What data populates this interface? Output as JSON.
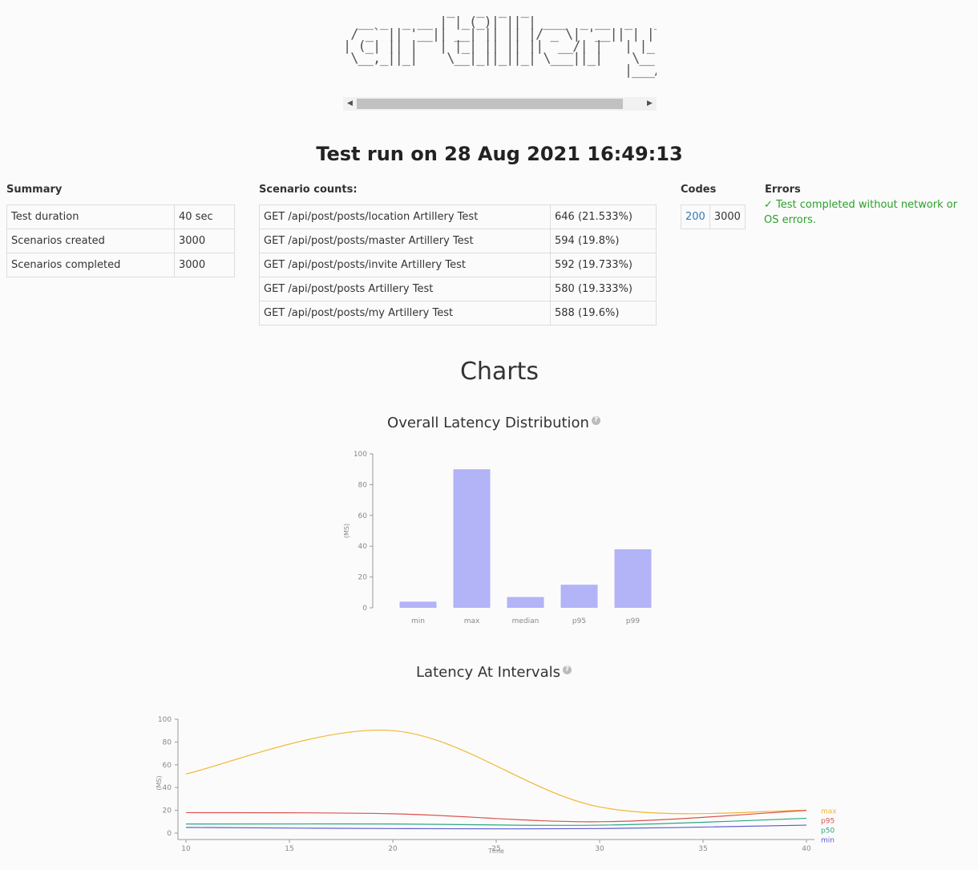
{
  "header": {
    "logo_ascii": "              _   _  _  _\n  __ _  _ __ | |_(_)| || | ___  _ __  _   _    _ __  ___  _ __    ___   _ __ | |_\n / _` || '__|| __| || || |/ _ \\| '__|| | | |  | '__|/ _ \\| '_ \\  / _ \\ | '__|| __|\n| (_| || |   | |_| || || ||  __/| |   | |_| |  | |  |  __/| |_) || (_) || |   | |_\n \\__,_||_|    \\__|_||_||_| \\___||_|    \\__, |  |_|   \\___|| .__/  \\___/ |_|    \\__|\n                                      |___/              |_|",
    "title": "Test run on 28 Aug 2021 16:49:13"
  },
  "summary": {
    "label": "Summary",
    "rows": [
      {
        "name": "Test duration",
        "value": "40 sec"
      },
      {
        "name": "Scenarios created",
        "value": "3000"
      },
      {
        "name": "Scenarios completed",
        "value": "3000"
      }
    ]
  },
  "scenarios": {
    "label": "Scenario counts:",
    "rows": [
      {
        "name": "GET /api/post/posts/location Artillery Test",
        "value": "646 (21.533%)"
      },
      {
        "name": "GET /api/post/posts/master Artillery Test",
        "value": "594 (19.8%)"
      },
      {
        "name": "GET /api/post/posts/invite Artillery Test",
        "value": "592 (19.733%)"
      },
      {
        "name": "GET /api/post/posts Artillery Test",
        "value": "580 (19.333%)"
      },
      {
        "name": "GET /api/post/posts/my Artillery Test",
        "value": "588 (19.6%)"
      }
    ]
  },
  "codes": {
    "label": "Codes",
    "code": "200",
    "count": "3000"
  },
  "errors": {
    "label": "Errors",
    "message": "✓ Test completed without network or OS errors."
  },
  "charts_heading": "Charts",
  "help_glyph": "?",
  "colors": {
    "bar": "#b3b3f7",
    "max": "#f2b632",
    "p95": "#d9534f",
    "p50": "#2ca87f",
    "min": "#5c5cd6"
  },
  "chart_data": [
    {
      "type": "bar",
      "title": "Overall Latency Distribution",
      "ylabel": "(MS)",
      "ylim": [
        0,
        100
      ],
      "yticks": [
        0,
        20,
        40,
        60,
        80,
        100
      ],
      "categories": [
        "min",
        "max",
        "median",
        "p95",
        "p99"
      ],
      "values": [
        4,
        90,
        7,
        15,
        38
      ]
    },
    {
      "type": "line",
      "title": "Latency At Intervals",
      "xlabel": "Time",
      "ylabel": "(MS)",
      "ylim": [
        0,
        100
      ],
      "xlim": [
        10,
        40
      ],
      "yticks": [
        0,
        20,
        40,
        60,
        80,
        100
      ],
      "xticks": [
        10,
        15,
        20,
        25,
        30,
        35,
        40
      ],
      "x": [
        10,
        20,
        30,
        40
      ],
      "series": [
        {
          "name": "max",
          "values": [
            52,
            90,
            23,
            20
          ]
        },
        {
          "name": "p95",
          "values": [
            18,
            17,
            10,
            20
          ]
        },
        {
          "name": "p50",
          "values": [
            8,
            8,
            7,
            13
          ]
        },
        {
          "name": "min",
          "values": [
            5,
            4,
            4,
            7
          ]
        }
      ]
    }
  ]
}
